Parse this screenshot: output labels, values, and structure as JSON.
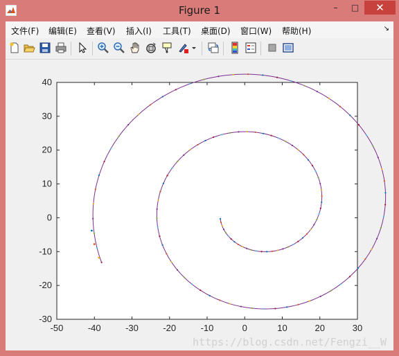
{
  "window": {
    "title": "Figure 1",
    "minimize_glyph": "–",
    "maximize_glyph": "□",
    "close_glyph": "✕"
  },
  "menu": {
    "items": [
      "文件(F)",
      "编辑(E)",
      "查看(V)",
      "插入(I)",
      "工具(T)",
      "桌面(D)",
      "窗口(W)",
      "帮助(H)"
    ],
    "overflow_glyph": "↘"
  },
  "toolbar": {
    "icons": [
      "new-figure-icon",
      "open-file-icon",
      "save-icon",
      "print-icon",
      "pointer-icon",
      "zoom-in-icon",
      "zoom-out-icon",
      "pan-icon",
      "rotate-3d-icon",
      "data-cursor-icon",
      "brush-icon",
      "link-plot-icon",
      "colorbar-icon",
      "legend-icon",
      "hide-plot-tools-icon",
      "show-plot-tools-icon"
    ]
  },
  "watermark": "https://blog.csdn.net/Fengzi__W",
  "chart_data": {
    "type": "line",
    "title": "",
    "xlabel": "",
    "ylabel": "",
    "xlim": [
      -50,
      30
    ],
    "ylim": [
      -30,
      40
    ],
    "xticks": [
      -50,
      -40,
      -30,
      -20,
      -10,
      0,
      10,
      20,
      30
    ],
    "yticks": [
      -30,
      -20,
      -10,
      0,
      10,
      20,
      30,
      40
    ],
    "grid": false,
    "series": [
      {
        "line_color": "#7b2e8f",
        "marker": "dots",
        "marker_colors": [
          "#0072bd",
          "#d95319",
          "#edb120",
          "#7e2f8e",
          "#77ac30",
          "#4dbeee",
          "#a2142f"
        ]
      }
    ],
    "spiral": {
      "start": [
        -6.5,
        -0.3
      ],
      "outer_end": [
        -40.8,
        -3.5
      ],
      "max_angle_deg": 720
    },
    "outliers": [
      {
        "x": -40.7,
        "y": -3.8,
        "color": "#0072bd"
      },
      {
        "x": -40.0,
        "y": -7.8,
        "color": "#d95319"
      },
      {
        "x": -38.8,
        "y": -11.8,
        "color": "#edb120"
      }
    ]
  }
}
